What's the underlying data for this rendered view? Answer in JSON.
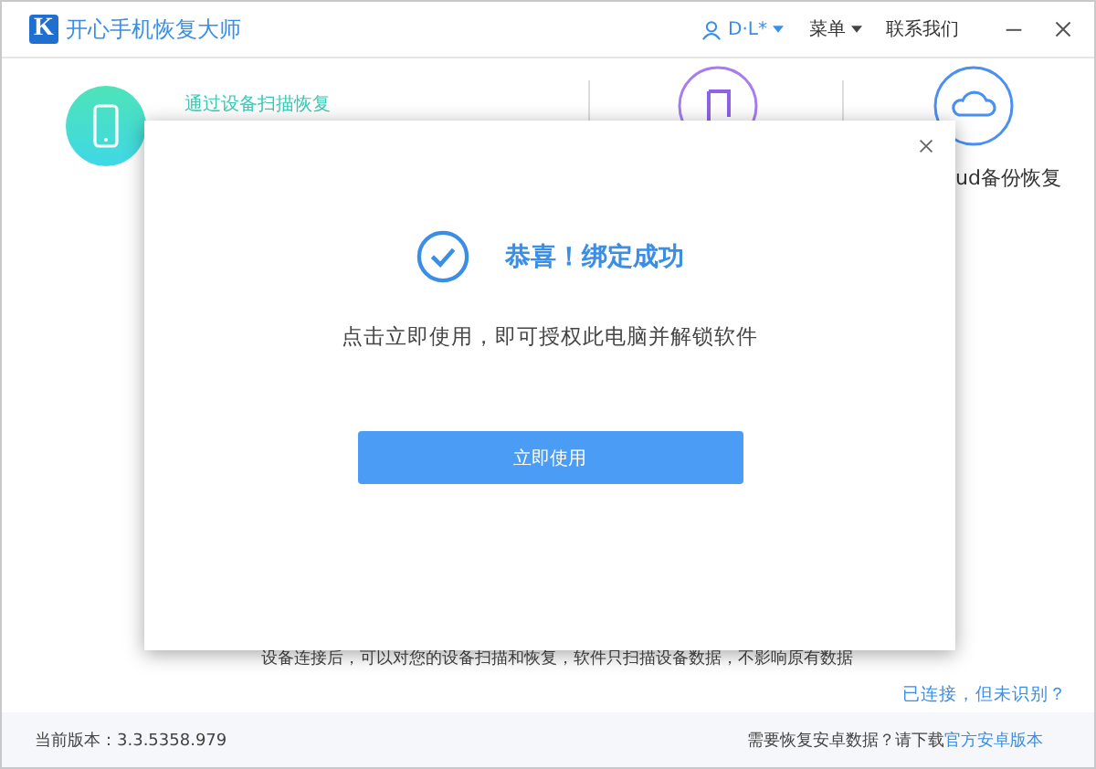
{
  "window": {
    "logo": "K",
    "title": "开心手机恢复大师",
    "user": "D·L*",
    "menu": "菜单",
    "contact": "联系我们"
  },
  "modes": [
    {
      "kind": "device",
      "label": "通过设备扫描恢复"
    },
    {
      "kind": "itunes"
    },
    {
      "kind": "icloud",
      "label": "ud备份恢复"
    }
  ],
  "dialog": {
    "title": "恭喜！绑定成功",
    "message": "点击立即使用，即可授权此电脑并解锁软件",
    "button": "立即使用"
  },
  "hint": "设备连接后，可以对您的设备扫描和恢复，软件只扫描设备数据，不影响原有数据",
  "help_link": "已连接，但未识别？",
  "status_bar": {
    "version": "当前版本：3.3.5358.979",
    "android_prompt": "需要恢复安卓数据？请下载",
    "android_link": "官方安卓版本"
  }
}
